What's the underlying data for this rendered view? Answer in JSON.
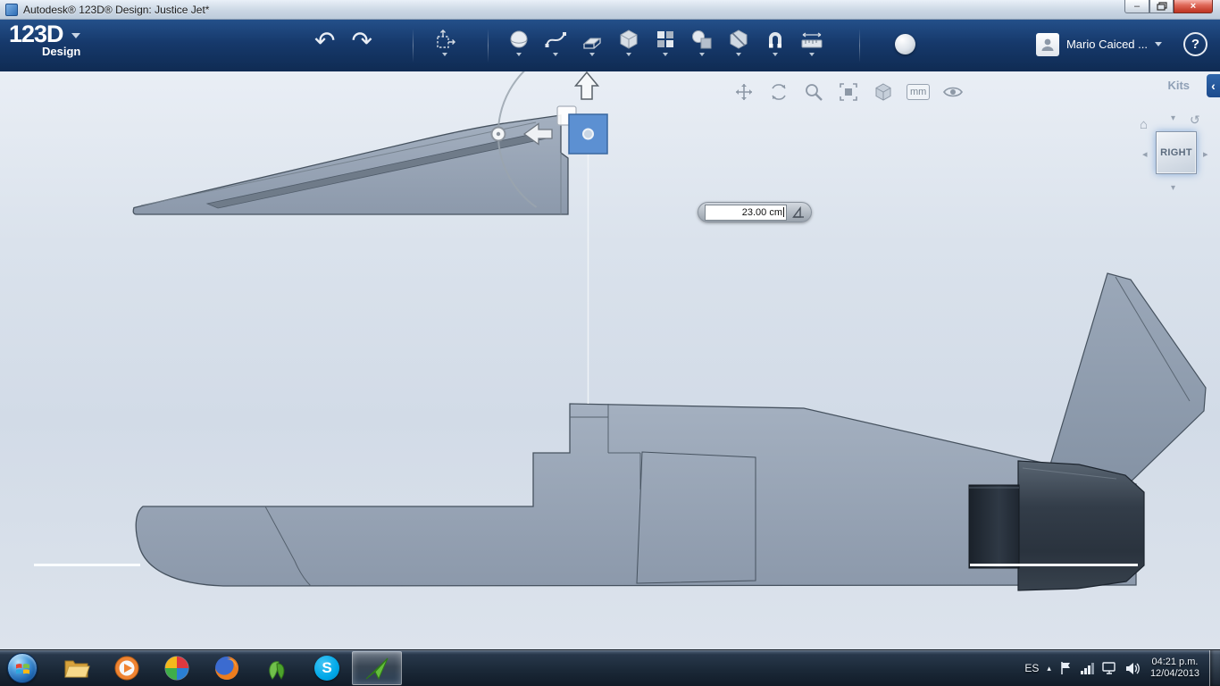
{
  "window": {
    "title": "Autodesk® 123D® Design: Justice Jet*"
  },
  "glyphs": {
    "minimize": "–",
    "close": "×",
    "undo": "↶",
    "redo": "↷",
    "chevron_left": "‹",
    "home": "⌂",
    "rotate_ccw": "↺",
    "triangle_left": "◂",
    "triangle_right": "▸",
    "triangle_down": "▾",
    "triangle_up": "▴",
    "help": "?"
  },
  "appbar": {
    "logo_text": "123D",
    "logo_sub": "Design",
    "user_name": "Mario Caiced ...",
    "tool_icons": [
      "undo-icon",
      "redo-icon",
      "transform-icon",
      "primitives-icon",
      "sketch-icon",
      "construct-icon",
      "modify-icon",
      "pattern-icon",
      "grouping-icon",
      "combine-icon",
      "snap-icon",
      "measure-icon",
      "render-sphere-icon"
    ]
  },
  "canvas": {
    "kits_label": "Kits",
    "viewcube_face": "RIGHT",
    "dimension_value": "23.00 cm",
    "units_label": "mm",
    "nav_icons": [
      "pan-icon",
      "orbit-icon",
      "zoom-icon",
      "fit-view-icon",
      "shaded-view-icon",
      "units-badge",
      "visibility-icon"
    ]
  },
  "taskbar": {
    "language": "ES",
    "time": "04:21 p.m.",
    "date": "12/04/2013",
    "skype_letter": "S",
    "app_icons": [
      "start-orb",
      "windows-explorer-icon",
      "media-player-icon",
      "media-center-icon",
      "firefox-icon",
      "messenger-icon",
      "skype-icon",
      "app-123d-design-icon"
    ]
  }
}
